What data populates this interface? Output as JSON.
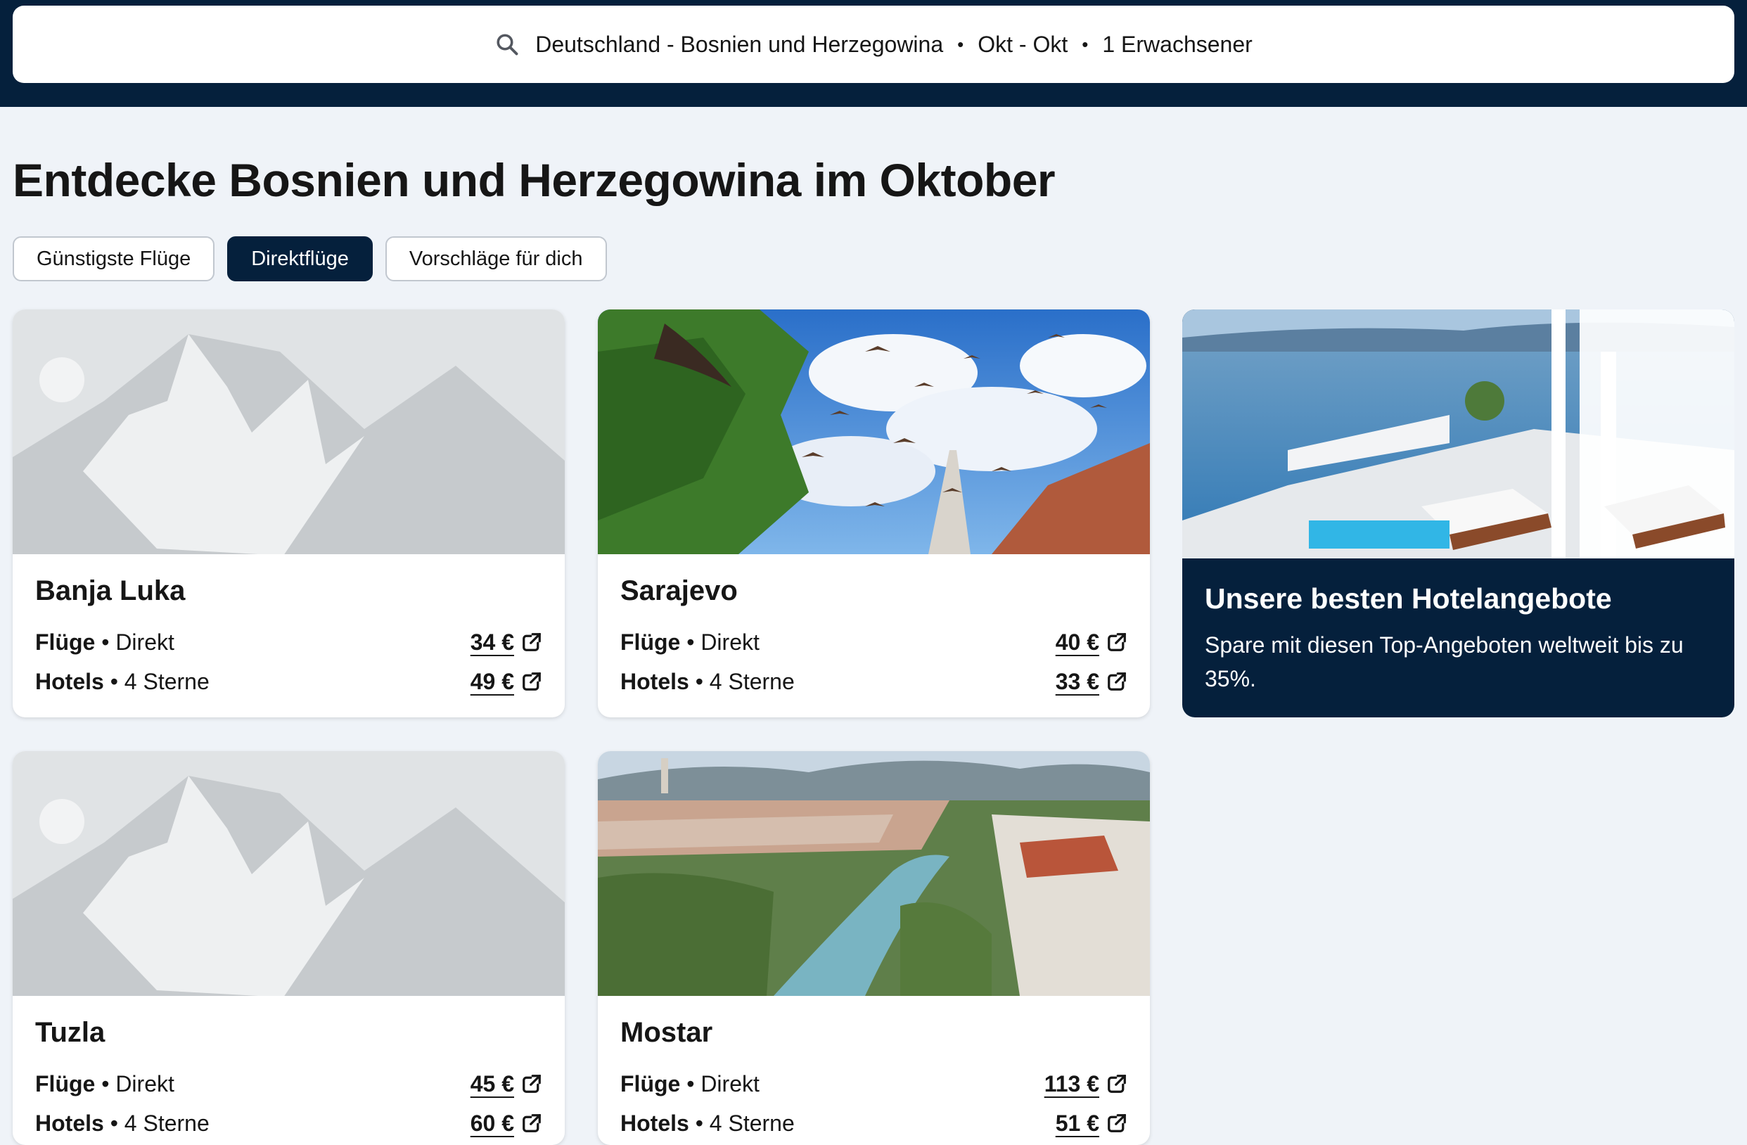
{
  "search": {
    "route": "Deutschland - Bosnien und Herzegowina",
    "dates": "Okt - Okt",
    "travellers": "1 Erwachsener",
    "separator": "•"
  },
  "page": {
    "title": "Entdecke Bosnien und Herzegowina im Oktober"
  },
  "filters": [
    {
      "label": "Günstigste Flüge",
      "active": false
    },
    {
      "label": "Direktflüge",
      "active": true
    },
    {
      "label": "Vorschläge für dich",
      "active": false
    }
  ],
  "destinations": [
    {
      "city": "Banja Luka",
      "flights_label": "Flüge",
      "flights_type": "Direkt",
      "flights_price": "34 €",
      "hotels_label": "Hotels",
      "hotels_stars": "4 Sterne",
      "hotels_price": "49 €"
    },
    {
      "city": "Sarajevo",
      "flights_label": "Flüge",
      "flights_type": "Direkt",
      "flights_price": "40 €",
      "hotels_label": "Hotels",
      "hotels_stars": "4 Sterne",
      "hotels_price": "33 €"
    },
    {
      "city": "Tuzla",
      "flights_label": "Flüge",
      "flights_type": "Direkt",
      "flights_price": "45 €",
      "hotels_label": "Hotels",
      "hotels_stars": "4 Sterne",
      "hotels_price": "60 €"
    },
    {
      "city": "Mostar",
      "flights_label": "Flüge",
      "flights_type": "Direkt",
      "flights_price": "113 €",
      "hotels_label": "Hotels",
      "hotels_stars": "4 Sterne",
      "hotels_price": "51 €"
    }
  ],
  "promo": {
    "title": "Unsere besten Hotelangebote",
    "text": "Spare mit diesen Top-Angeboten weltweit bis zu 35%."
  },
  "colors": {
    "header": "#05203c",
    "background": "#eff3f8",
    "placeholder": "#e0e3e5"
  },
  "icons": {
    "search": "search-icon",
    "external": "external-link-icon"
  }
}
